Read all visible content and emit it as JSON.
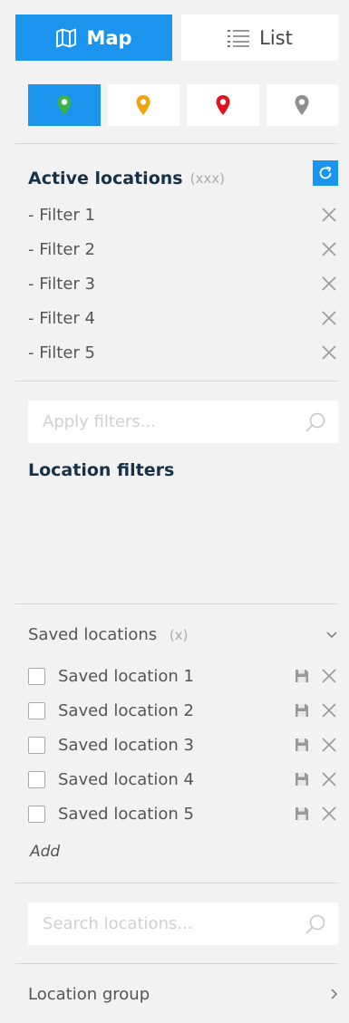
{
  "view_toggle": {
    "map_label": "Map",
    "list_label": "List",
    "map_icon": "map-icon",
    "list_icon": "list-icon"
  },
  "pins": [
    {
      "name": "green-pin",
      "color": "#3cb34a",
      "active": true
    },
    {
      "name": "orange-pin",
      "color": "#f0a30a",
      "active": false
    },
    {
      "name": "red-pin",
      "color": "#e0141e",
      "active": false
    },
    {
      "name": "gray-pin",
      "color": "#8f8f8f",
      "active": false
    }
  ],
  "active_locations": {
    "title": "Active locations",
    "count": "(xxx)",
    "filters": [
      "- Filter 1",
      "- Filter 2",
      "- Filter 3",
      "- Filter 4",
      "- Filter 5"
    ]
  },
  "apply_filters": {
    "placeholder": "Apply filters..."
  },
  "location_filters": {
    "title": "Location filters"
  },
  "saved_locations": {
    "title": "Saved locations",
    "count": "(x)",
    "items": [
      "Saved location 1",
      "Saved location 2",
      "Saved location 3",
      "Saved location 4",
      "Saved location 5"
    ],
    "add_label": "Add"
  },
  "search_locations": {
    "placeholder": "Search locations..."
  },
  "location_group": {
    "label": "Location group"
  },
  "colors": {
    "accent": "#1a94ec",
    "heading": "#163148"
  }
}
